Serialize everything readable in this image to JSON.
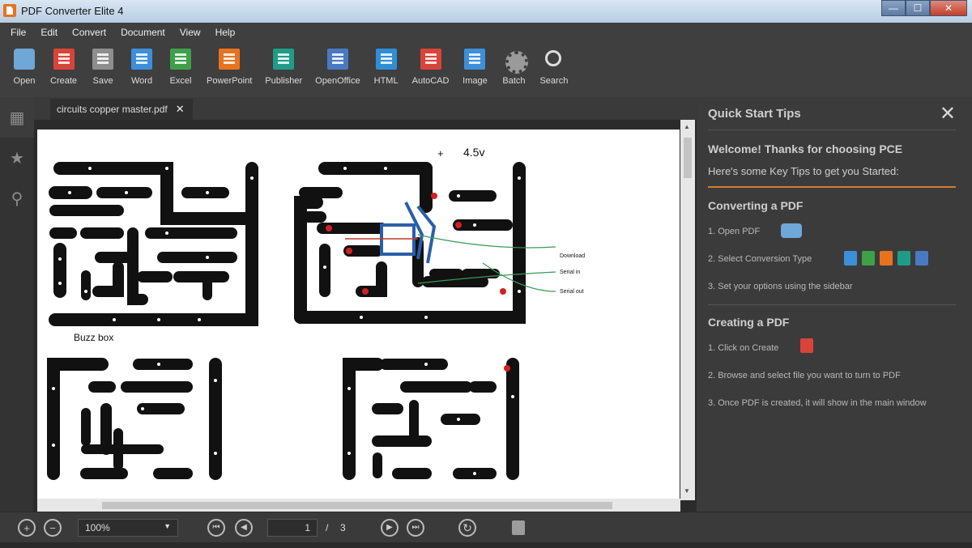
{
  "window": {
    "title": "PDF Converter Elite 4",
    "controls": [
      "—",
      "☐",
      "✕"
    ]
  },
  "menu": [
    "File",
    "Edit",
    "Convert",
    "Document",
    "View",
    "Help"
  ],
  "toolbar": [
    {
      "label": "Open",
      "icon": "folder-icon",
      "color": "#6ea7d8",
      "kind": "folder"
    },
    {
      "label": "Create",
      "icon": "create-pdf-icon",
      "color": "#d9443a",
      "kind": "doc"
    },
    {
      "label": "Save",
      "icon": "save-icon",
      "color": "#8e8e8e",
      "kind": "gray"
    },
    {
      "label": "Word",
      "icon": "word-icon",
      "color": "#3d8fd9",
      "kind": "doc"
    },
    {
      "label": "Excel",
      "icon": "excel-icon",
      "color": "#3fa04a",
      "kind": "doc"
    },
    {
      "label": "PowerPoint",
      "icon": "powerpoint-icon",
      "color": "#e8731e",
      "kind": "doc"
    },
    {
      "label": "Publisher",
      "icon": "publisher-icon",
      "color": "#1f9c88",
      "kind": "doc"
    },
    {
      "label": "OpenOffice",
      "icon": "openoffice-icon",
      "color": "#4a79c4",
      "kind": "doc"
    },
    {
      "label": "HTML",
      "icon": "html-icon",
      "color": "#2f8fd6",
      "kind": "doc"
    },
    {
      "label": "AutoCAD",
      "icon": "autocad-icon",
      "color": "#d9443a",
      "kind": "doc"
    },
    {
      "label": "Image",
      "icon": "image-icon",
      "color": "#3d8fd9",
      "kind": "doc"
    },
    {
      "label": "Batch",
      "icon": "gear-icon",
      "color": "#9a9a9a",
      "kind": "gear"
    },
    {
      "label": "Search",
      "icon": "search-icon",
      "color": "#dddddd",
      "kind": "search"
    }
  ],
  "document": {
    "tab_name": "circuits copper master.pdf",
    "labels": {
      "buzz_box": "Buzz box",
      "plus": "+",
      "voltage": "4.5v",
      "download": "Download",
      "serial_in": "Serial in",
      "serial_out": "Serial out"
    }
  },
  "tips": {
    "title": "Quick Start Tips",
    "welcome": "Welcome! Thanks for choosing PCE",
    "welcome_sub": "Here's some Key Tips to get you Started:",
    "converting_title": "Converting a PDF",
    "converting_steps": [
      "1. Open PDF",
      "2. Select Conversion Type",
      "3. Set your options using the sidebar"
    ],
    "creating_title": "Creating a PDF",
    "creating_steps": [
      "1. Click on Create",
      "2. Browse and select file you want to turn to PDF",
      "3. Once PDF is created, it will show in the main window"
    ]
  },
  "status": {
    "zoom": "100%",
    "current_page": "1",
    "separator": "/",
    "total_pages": "3"
  }
}
